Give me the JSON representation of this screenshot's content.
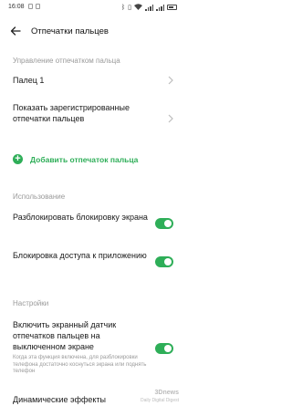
{
  "status_bar": {
    "time": "16:08",
    "battery_percent": "100"
  },
  "header": {
    "title": "Отпечатки пальцев"
  },
  "fingerprint_management": {
    "section_title": "Управление отпечатком пальца",
    "finger_1_label": "Палец 1",
    "show_registered_label": "Показать зарегистрированные отпечатки пальцев",
    "add_fingerprint_label": "Добавить отпечаток пальца"
  },
  "usage": {
    "section_title": "Использование",
    "unlock_screen_label": "Разблокировать блокировку экрана",
    "unlock_screen_on": true,
    "app_lock_label": "Блокировка доступа к приложению",
    "app_lock_on": true
  },
  "settings": {
    "section_title": "Настройки",
    "screen_off_sensor_label": "Включить экранный датчик отпечатков пальцев на выключенном экране",
    "screen_off_sensor_on": true,
    "screen_off_sensor_desc": "Когда эта функция включена, для разблокировки телефона достаточно коснуться экрана или поднять телефон",
    "dynamic_effects_label": "Динамические эффекты"
  },
  "watermark": {
    "text": "3Dnews",
    "sub": "Daily Digital Digest"
  },
  "colors": {
    "accent": "#2eae58",
    "section_header": "#9a9a9a"
  }
}
